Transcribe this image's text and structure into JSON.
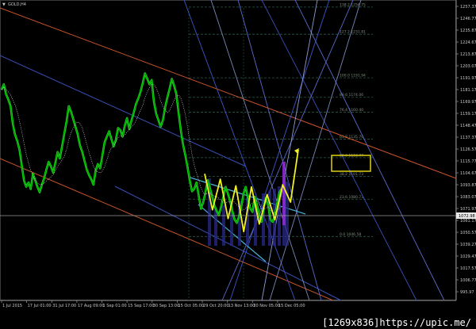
{
  "chart_data": {
    "type": "line",
    "symbol": "GOLD,H4",
    "y_ticks": [
      "1257.37",
      "1246.77",
      "1235.87",
      "1224.67",
      "1213.87",
      "1203.07",
      "1191.97",
      "1181.17",
      "1169.97",
      "1159.17",
      "1148.47",
      "1137.37",
      "1126.57",
      "1115.77",
      "1104.67",
      "1093.87",
      "1083.07",
      "1071.97",
      "1061.17",
      "1050.57",
      "1039.27",
      "1029.47",
      "1017.57",
      "1006.77",
      "995.97"
    ],
    "current_price": "1072.98",
    "x_ticks": [
      "1 Jul 2015",
      "17 Jul 01:00",
      "31 Jul 17:00",
      "17 Aug 09:00",
      "1 Sep 01:00",
      "15 Sep 17:00",
      "30 Sep 13:00",
      "15 Oct 05:00",
      "29 Oct 20:00",
      "13 Nov 13:00",
      "30 Nov 05:00",
      "15 Dec 05:00"
    ],
    "fib_levels": [
      {
        "label": "138.2  1256.75"
      },
      {
        "label": "127.2  1231.81"
      },
      {
        "label": "100.0  1191.94"
      },
      {
        "label": "88.6  1174.06"
      },
      {
        "label": "76.4  1160.40"
      },
      {
        "label": "61.8  1135.70"
      },
      {
        "label": "50.0  1118.77"
      },
      {
        "label": "38.2  1101.73"
      },
      {
        "label": "23.6  1080.73"
      },
      {
        "label": "0.0  1046.58"
      }
    ],
    "price_path": [
      1181,
      1186,
      1177,
      1172,
      1166,
      1150,
      1140,
      1134,
      1126,
      1112,
      1098,
      1092,
      1096,
      1090,
      1104,
      1098,
      1092,
      1087,
      1094,
      1100,
      1108,
      1115,
      1111,
      1105,
      1114,
      1124,
      1118,
      1129,
      1141,
      1152,
      1166,
      1161,
      1154,
      1147,
      1140,
      1130,
      1124,
      1116,
      1108,
      1103,
      1099,
      1094,
      1107,
      1113,
      1109,
      1121,
      1133,
      1138,
      1143,
      1136,
      1129,
      1135,
      1146,
      1144,
      1138,
      1148,
      1155,
      1145,
      1153,
      1160,
      1168,
      1173,
      1179,
      1187,
      1196,
      1191,
      1186,
      1190,
      1170,
      1159,
      1153,
      1147,
      1153,
      1165,
      1174,
      1182,
      1191,
      1185,
      1177,
      1160,
      1144,
      1131,
      1121,
      1110,
      1098,
      1088,
      1090,
      1096,
      1084,
      1072,
      1078,
      1087,
      1098,
      1091,
      1083,
      1075,
      1070,
      1066,
      1074,
      1083,
      1092,
      1086,
      1079,
      1070,
      1062,
      1059,
      1065,
      1074,
      1086,
      1092,
      1081,
      1072,
      1069,
      1083,
      1076,
      1066,
      1060,
      1073,
      1082,
      1075,
      1062,
      1060,
      1066,
      1077,
      1087,
      1090
    ],
    "zigzag": [
      1104,
      1071,
      1099,
      1063,
      1093,
      1051,
      1092,
      1058,
      1085,
      1062,
      1094,
      1078,
      1126
    ]
  },
  "watermark": "[1269x836]https://upic.me/"
}
